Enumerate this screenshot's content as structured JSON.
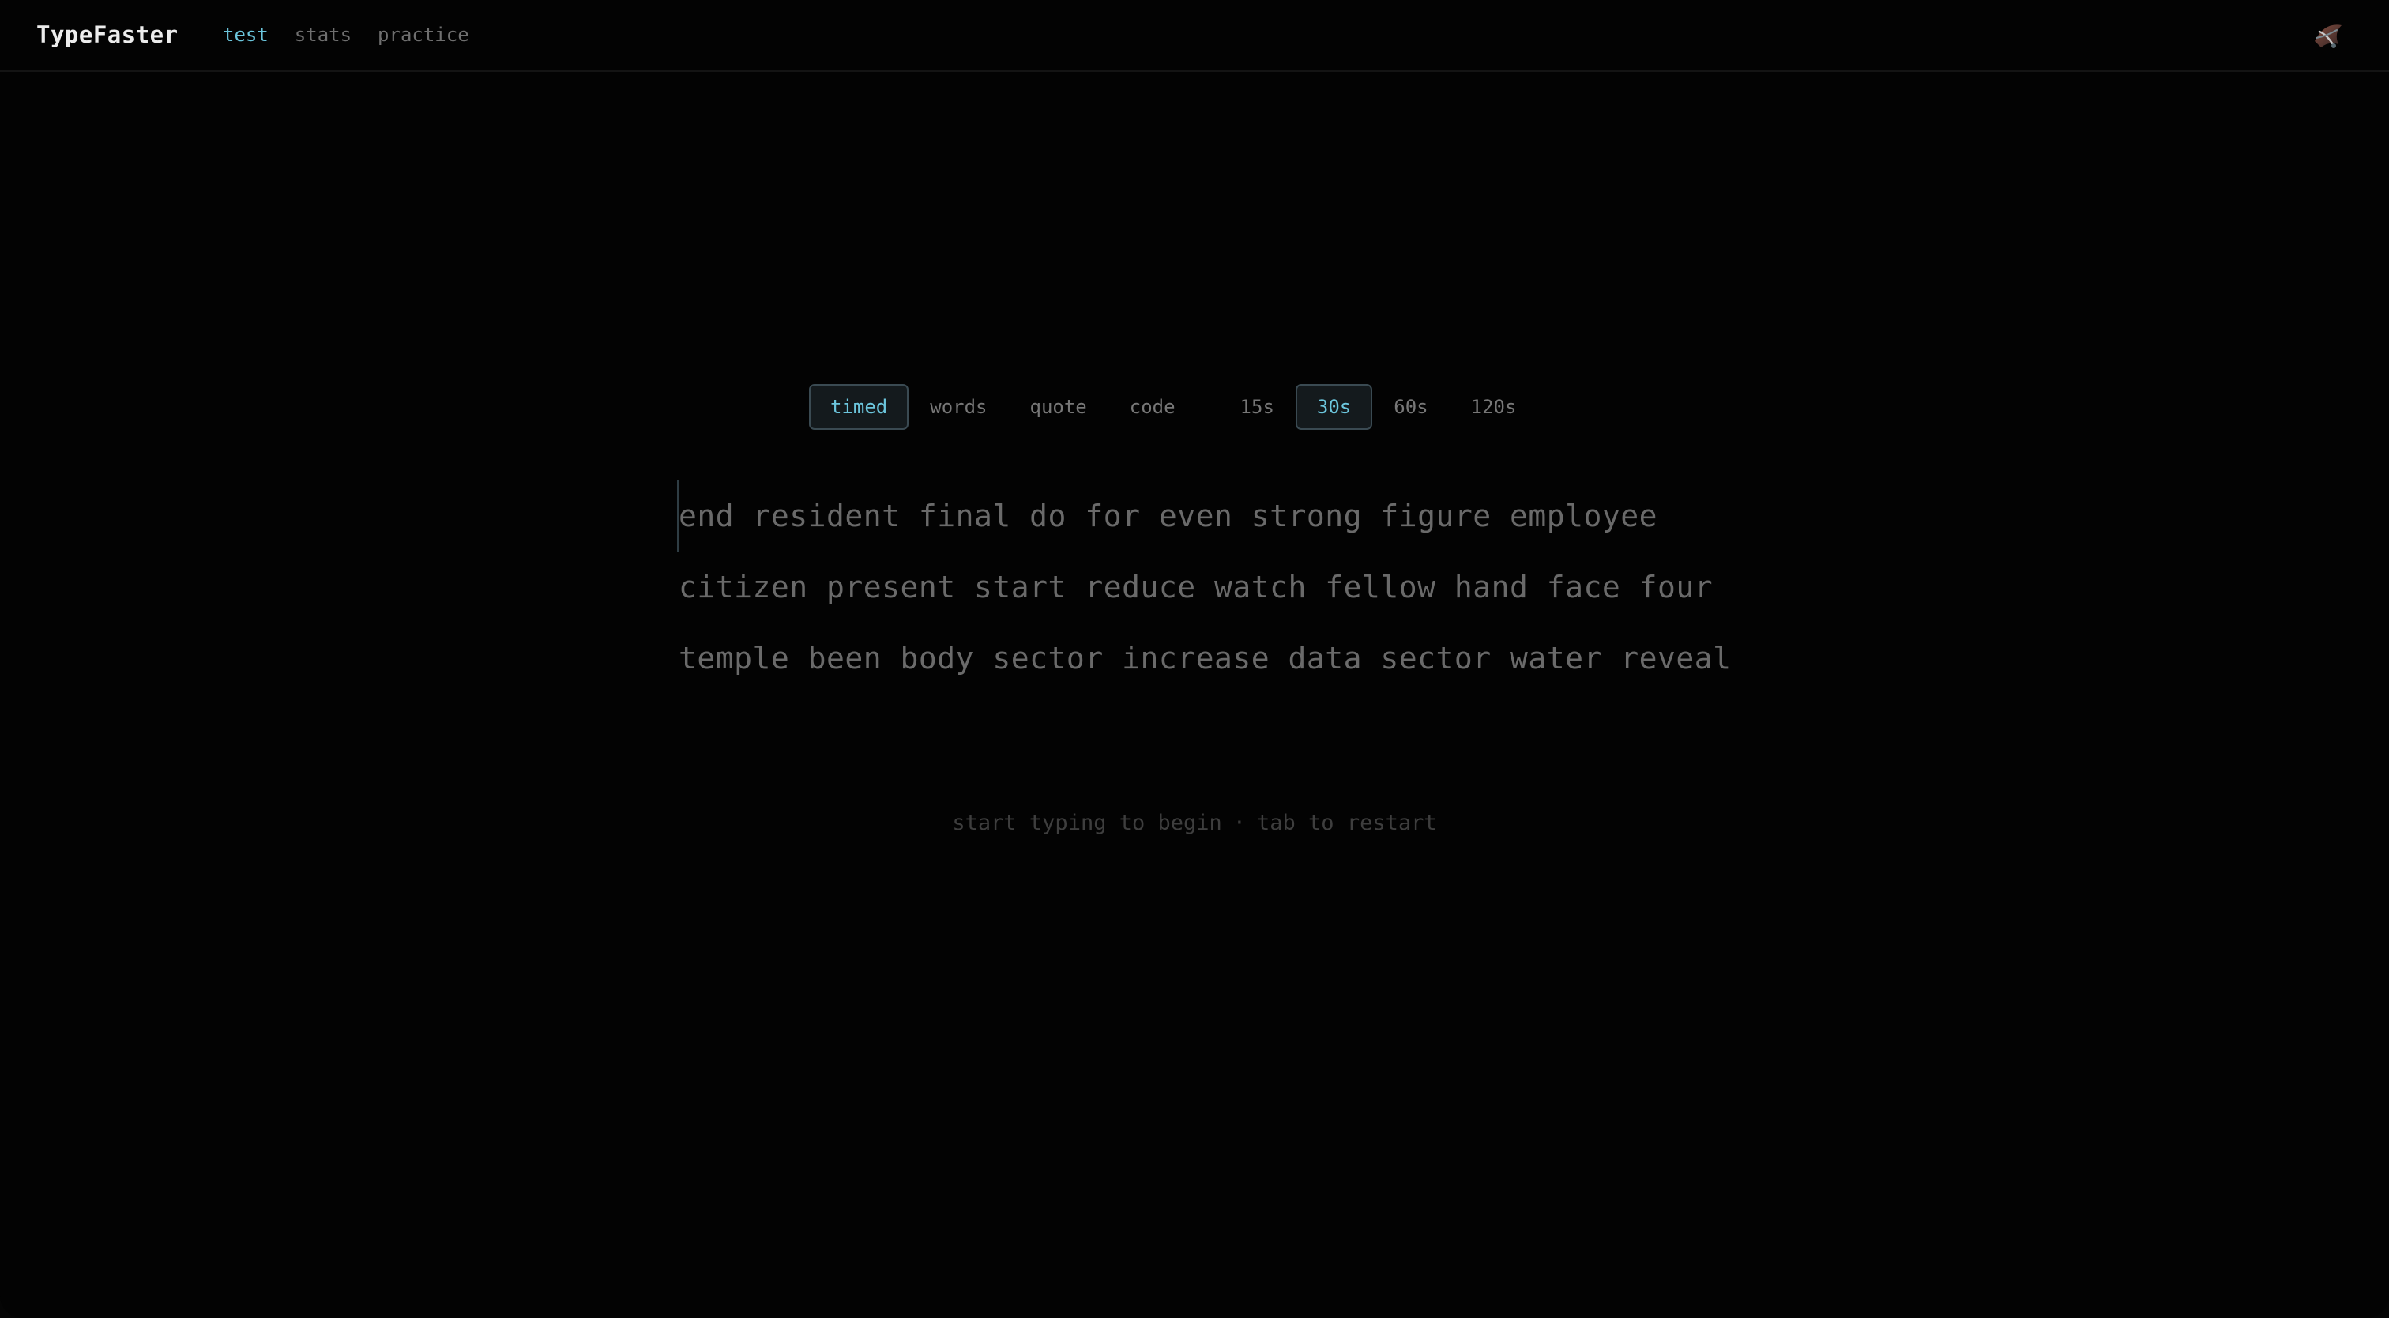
{
  "header": {
    "brand": "TypeFaster",
    "nav": [
      {
        "label": "test",
        "active": true
      },
      {
        "label": "stats",
        "active": false
      },
      {
        "label": "practice",
        "active": false
      }
    ],
    "avatar_icon": "avatar-icon"
  },
  "modes": [
    {
      "label": "timed",
      "active": true
    },
    {
      "label": "words",
      "active": false
    },
    {
      "label": "quote",
      "active": false
    },
    {
      "label": "code",
      "active": false
    }
  ],
  "durations": [
    {
      "label": "15s",
      "active": false
    },
    {
      "label": "30s",
      "active": true
    },
    {
      "label": "60s",
      "active": false
    },
    {
      "label": "120s",
      "active": false
    }
  ],
  "test": {
    "lines": [
      "end resident final do for even strong figure employee",
      "citizen present start reduce watch fellow hand face four",
      "temple been body sector increase data sector water reveal"
    ]
  },
  "hint": {
    "start": "start typing to begin",
    "separator": "·",
    "restart": "tab to restart"
  },
  "colors": {
    "accent": "#6cc6dd",
    "background": "#030303",
    "text_dim": "#6a6a6a"
  }
}
